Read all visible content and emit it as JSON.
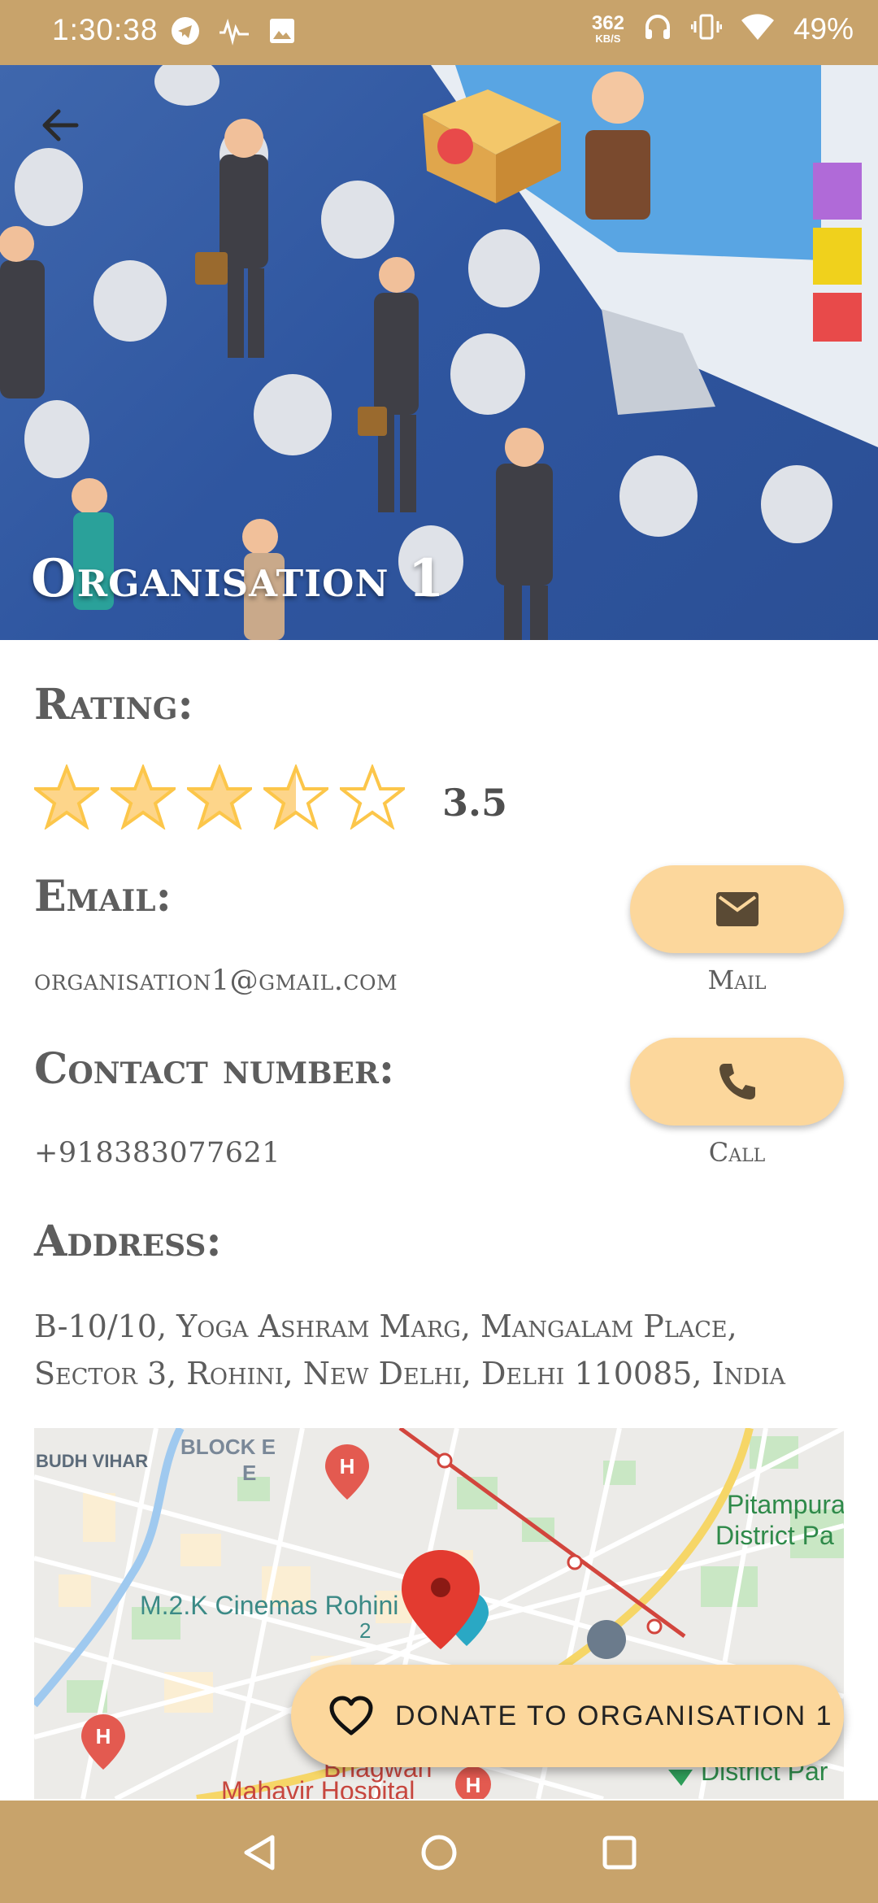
{
  "status_bar": {
    "time": "1:30:38",
    "net_speed_value": "362",
    "net_speed_unit": "KB/S",
    "battery": "49%",
    "icons": [
      "telegram-icon",
      "signal-activity-icon",
      "image-icon",
      "headphones-icon",
      "vibrate-icon",
      "wifi-icon"
    ]
  },
  "header": {
    "title": "Organisation 1",
    "back_icon": "arrow-left-icon"
  },
  "rating": {
    "heading": "Rating:",
    "value": "3.5",
    "stars_total": 5,
    "stars_filled": 3.5,
    "star_color": "#fcc64a"
  },
  "email": {
    "heading": "Email:",
    "value": "organisation1@gmail.com",
    "button_icon": "mail-icon",
    "button_label": "Mail"
  },
  "contact": {
    "heading": "Contact number:",
    "value": "+918383077621",
    "button_icon": "phone-icon",
    "button_label": "Call"
  },
  "address": {
    "heading": "Address:",
    "line1": "B-10/10, Yoga Ashram Marg, Mangalam Place,",
    "line2": "Sector 3, Rohini, New Delhi, Delhi 110085, India"
  },
  "map": {
    "labels": {
      "budh_vihar": "BUDH VIHAR",
      "block_e": "BLOCK E",
      "block_e_letter": "E",
      "cinema": "M.2.K Cinemas Rohini",
      "cinema_num": "2",
      "pitampura_1": "Pitampura",
      "pitampura_2": "District Pa",
      "bhagwan": "Bhagwan",
      "mahavir": "Mahavir Hospital",
      "district_park": "District Par"
    }
  },
  "donate": {
    "label": "DONATE TO ORGANISATION 1",
    "icon": "heart-outline-icon"
  },
  "nav_bar": {
    "icons": [
      "back-triangle-icon",
      "home-circle-icon",
      "recents-square-icon"
    ]
  },
  "colors": {
    "primary": "#c8a36b",
    "button": "#fcd79c",
    "text": "#5d5d5d"
  }
}
